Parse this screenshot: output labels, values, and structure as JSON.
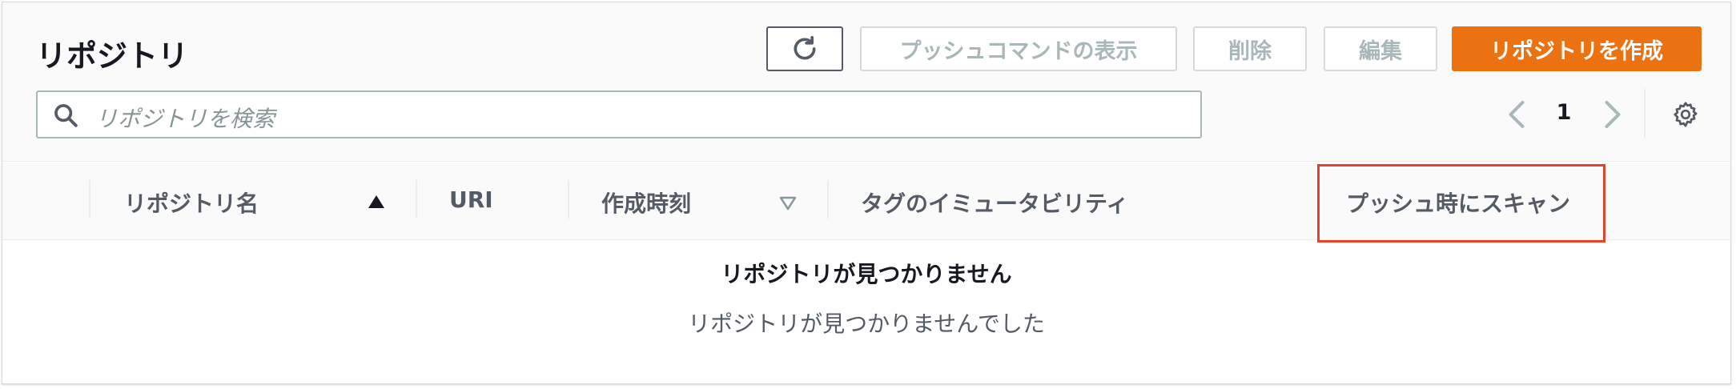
{
  "header": {
    "title": "リポジトリ",
    "buttons": {
      "refresh_icon": "refresh-icon",
      "push_commands": "プッシュコマンドの表示",
      "delete": "削除",
      "edit": "編集",
      "create": "リポジトリを作成"
    },
    "search": {
      "placeholder": "リポジトリを検索",
      "icon": "search-icon"
    },
    "pagination": {
      "current_page": "1"
    },
    "settings_icon": "gear-icon"
  },
  "table": {
    "columns": [
      {
        "label": "リポジトリ名",
        "sort": "ascending"
      },
      {
        "label": "URI"
      },
      {
        "label": "作成時刻",
        "sort": "sortable"
      },
      {
        "label": "タグのイミュータビリティ"
      },
      {
        "label": "プッシュ時にスキャン",
        "highlighted": true
      }
    ],
    "empty": {
      "title": "リポジトリが見つかりません",
      "description": "リポジトリが見つかりませんでした"
    }
  },
  "colors": {
    "primary": "#ec7211",
    "highlight": "#e0442b",
    "disabled_text": "#aab7b8"
  }
}
